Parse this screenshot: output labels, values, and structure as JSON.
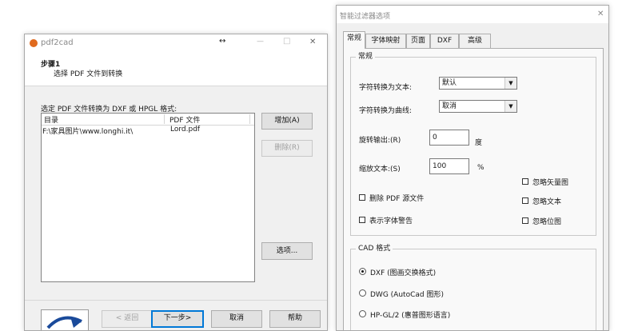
{
  "pdf2cad": {
    "title": "pdf2cad",
    "titlebar_resize_glyph": "↔",
    "minimize_glyph": "—",
    "maximize_glyph": "□",
    "close_glyph": "✕",
    "step_heading": "步骤1",
    "step_desc": "选择 PDF 文件到转换",
    "list_caption": "选定 PDF 文件转换为 DXF 或 HPGL 格式:",
    "columns": [
      "目录",
      "PDF 文件"
    ],
    "rows": [
      {
        "dir": "F:\\家具图片\\www.longhi.it\\",
        "file": "Lord.pdf"
      }
    ],
    "btn_add": "增加(A)",
    "btn_delete": "删除(R)",
    "btn_options": "选项...",
    "btn_back": "< 返回",
    "btn_next": "下一步>",
    "btn_cancel": "取消",
    "btn_help": "帮助"
  },
  "filter": {
    "title": "智能过滤器选项",
    "close_glyph": "✕",
    "tabs": [
      "常规",
      "字体映射",
      "页面",
      "DXF",
      "高级"
    ],
    "group_general": "常规",
    "char_to_text_label": "字符转换为文本:",
    "char_to_text_value": "默认",
    "char_to_curve_label": "字符转换为曲线:",
    "char_to_curve_value": "取消",
    "rotate_label": "旋转输出:(R)",
    "rotate_value": "0",
    "rotate_unit": "度",
    "scale_label": "缩放文本:(S)",
    "scale_value": "100",
    "scale_unit": "%",
    "ignore_vector": "忽略矢量图",
    "ignore_text": "忽略文本",
    "ignore_bitmap": "忽略位图",
    "delete_pdf": "删除 PDF 源文件",
    "font_warning": "表示字体警告",
    "group_cad": "CAD 格式",
    "cad_dxf": "DXF (图画交换格式)",
    "cad_dwg": "DWG (AutoCad 图形)",
    "cad_hpgl": "HP-GL/2 (惠普图形语言)"
  },
  "icons": {
    "app_icon_color": "#e06a1e",
    "accent_blue": "#0078d7"
  }
}
